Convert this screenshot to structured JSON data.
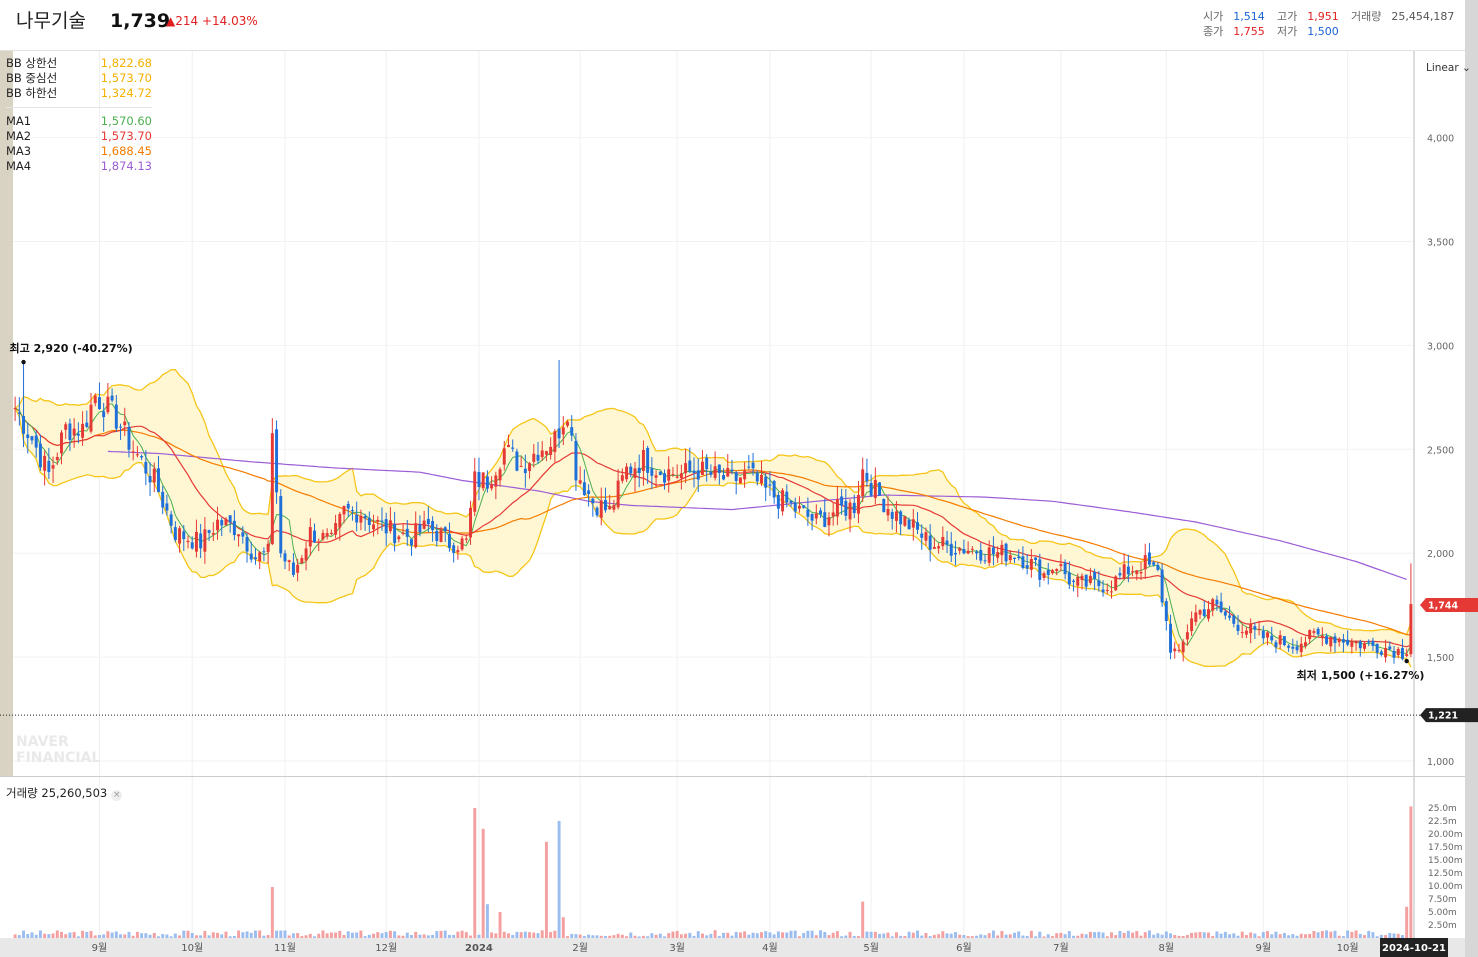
{
  "header": {
    "stock_name": "나무기술",
    "price": "1,739",
    "change": "▲214",
    "change_pct": "+14.03%",
    "open_label": "시가",
    "open": "1,514",
    "high_label": "고가",
    "high": "1,951",
    "volume_label": "거래량",
    "volume": "25,454,187",
    "close_label": "종가",
    "close": "1,755",
    "low_label": "저가",
    "low": "1,500"
  },
  "legend": {
    "bb": [
      {
        "label": "BB 상한선",
        "value": "1,822.68",
        "color": "#f5b100"
      },
      {
        "label": "BB 중심선",
        "value": "1,573.70",
        "color": "#f5b100"
      },
      {
        "label": "BB 하한선",
        "value": "1,324.72",
        "color": "#f5b100"
      }
    ],
    "ma": [
      {
        "label": "MA1",
        "value": "1,570.60",
        "color": "#4caf50"
      },
      {
        "label": "MA2",
        "value": "1,573.70",
        "color": "#e53935"
      },
      {
        "label": "MA3",
        "value": "1,688.45",
        "color": "#f57c00"
      },
      {
        "label": "MA4",
        "value": "1,874.13",
        "color": "#9c5dd6"
      }
    ]
  },
  "scale_mode": "Linear",
  "volume_label": "거래량 25,260,503",
  "watermark": "NAVER FINANCIAL",
  "chart_data": {
    "type": "candlestick",
    "y_ticks": [
      1000,
      1500,
      2000,
      2500,
      3000,
      3500,
      4000
    ],
    "y_tick_labels": [
      "1,000",
      "1,500",
      "2,000",
      "2,500",
      "3,000",
      "3,500",
      "4,000"
    ],
    "ylim": [
      900,
      4300
    ],
    "x_ticks": [
      {
        "i": 20,
        "label": "9월"
      },
      {
        "i": 42,
        "label": "10월"
      },
      {
        "i": 64,
        "label": "11월"
      },
      {
        "i": 88,
        "label": "12월"
      },
      {
        "i": 110,
        "label": "2024"
      },
      {
        "i": 134,
        "label": "2월"
      },
      {
        "i": 157,
        "label": "3월"
      },
      {
        "i": 179,
        "label": "4월"
      },
      {
        "i": 203,
        "label": "5월"
      },
      {
        "i": 225,
        "label": "6월"
      },
      {
        "i": 248,
        "label": "7월"
      },
      {
        "i": 273,
        "label": "8월"
      },
      {
        "i": 296,
        "label": "9월"
      },
      {
        "i": 316,
        "label": "10월"
      }
    ],
    "date_label": "2024-10-21",
    "price_tag": "1,744",
    "dotted_line_tag": "1,221",
    "dotted_line_value": 1221,
    "max_annotation": {
      "text": "최고 2,920 (-40.27%)",
      "i": 2,
      "value": 2920
    },
    "min_annotation": {
      "text": "최저 1,500 (+16.27%)",
      "i": 330,
      "value": 1500
    },
    "volume_ticks": [
      "2.50m",
      "5.00m",
      "7.50m",
      "10.00m",
      "12.50m",
      "15.00m",
      "17.50m",
      "20.00m",
      "22.5m",
      "25.0m"
    ],
    "volume_max": 25.0,
    "colors": {
      "up": "#e53935",
      "down": "#1e6fd9",
      "bb_fill": "#fff7d4",
      "bb_line": "#f5c518",
      "ma1": "#4caf50",
      "ma2": "#e53935",
      "ma3": "#f57c00",
      "ma4": "#9c5dd6"
    },
    "close_anchors": [
      [
        0,
        2700
      ],
      [
        4,
        2550
      ],
      [
        8,
        2380
      ],
      [
        12,
        2600
      ],
      [
        16,
        2600
      ],
      [
        19,
        2760
      ],
      [
        24,
        2650
      ],
      [
        28,
        2500
      ],
      [
        33,
        2350
      ],
      [
        38,
        2100
      ],
      [
        44,
        2050
      ],
      [
        48,
        2150
      ],
      [
        53,
        2120
      ],
      [
        57,
        1980
      ],
      [
        60,
        2000
      ],
      [
        61,
        2600
      ],
      [
        63,
        2000
      ],
      [
        66,
        1900
      ],
      [
        70,
        2100
      ],
      [
        75,
        2050
      ],
      [
        78,
        2200
      ],
      [
        82,
        2200
      ],
      [
        85,
        2150
      ],
      [
        90,
        2100
      ],
      [
        94,
        2080
      ],
      [
        98,
        2130
      ],
      [
        103,
        2050
      ],
      [
        107,
        2050
      ],
      [
        109,
        2350
      ],
      [
        112,
        2350
      ],
      [
        116,
        2500
      ],
      [
        120,
        2420
      ],
      [
        124,
        2500
      ],
      [
        128,
        2550
      ],
      [
        131,
        2700
      ],
      [
        133,
        2400
      ],
      [
        137,
        2250
      ],
      [
        141,
        2200
      ],
      [
        145,
        2400
      ],
      [
        149,
        2450
      ],
      [
        153,
        2400
      ],
      [
        158,
        2380
      ],
      [
        162,
        2400
      ],
      [
        166,
        2370
      ],
      [
        170,
        2350
      ],
      [
        174,
        2380
      ],
      [
        178,
        2300
      ],
      [
        182,
        2250
      ],
      [
        186,
        2200
      ],
      [
        190,
        2150
      ],
      [
        194,
        2200
      ],
      [
        199,
        2230
      ],
      [
        201,
        2400
      ],
      [
        204,
        2300
      ],
      [
        208,
        2200
      ],
      [
        213,
        2120
      ],
      [
        217,
        2050
      ],
      [
        222,
        2030
      ],
      [
        227,
        2020
      ],
      [
        232,
        2000
      ],
      [
        237,
        2000
      ],
      [
        241,
        1950
      ],
      [
        244,
        1900
      ],
      [
        247,
        1950
      ],
      [
        251,
        1850
      ],
      [
        256,
        1850
      ],
      [
        260,
        1850
      ],
      [
        264,
        1920
      ],
      [
        268,
        1950
      ],
      [
        271,
        1900
      ],
      [
        274,
        1550
      ],
      [
        276,
        1500
      ],
      [
        279,
        1700
      ],
      [
        284,
        1750
      ],
      [
        288,
        1680
      ],
      [
        291,
        1650
      ],
      [
        295,
        1600
      ],
      [
        299,
        1580
      ],
      [
        303,
        1560
      ],
      [
        308,
        1600
      ],
      [
        312,
        1600
      ],
      [
        316,
        1580
      ],
      [
        320,
        1560
      ],
      [
        324,
        1550
      ],
      [
        328,
        1530
      ],
      [
        330,
        1514
      ],
      [
        331,
        1755
      ]
    ],
    "ma4_anchors": [
      [
        22,
        2490
      ],
      [
        34,
        2480
      ],
      [
        56,
        2440
      ],
      [
        76,
        2410
      ],
      [
        96,
        2390
      ],
      [
        106,
        2350
      ],
      [
        124,
        2300
      ],
      [
        136,
        2250
      ],
      [
        146,
        2230
      ],
      [
        170,
        2210
      ],
      [
        190,
        2250
      ],
      [
        206,
        2280
      ],
      [
        230,
        2270
      ],
      [
        246,
        2250
      ],
      [
        264,
        2200
      ],
      [
        280,
        2150
      ],
      [
        300,
        2060
      ],
      [
        318,
        1960
      ],
      [
        330,
        1874
      ]
    ],
    "volume_spikes": [
      {
        "i": 61,
        "v": 9.8
      },
      {
        "i": 109,
        "v": 25.0
      },
      {
        "i": 111,
        "v": 21.0
      },
      {
        "i": 112,
        "v": 6.5
      },
      {
        "i": 115,
        "v": 5.0
      },
      {
        "i": 126,
        "v": 18.5
      },
      {
        "i": 129,
        "v": 22.5
      },
      {
        "i": 130,
        "v": 4.0
      },
      {
        "i": 201,
        "v": 7.0
      },
      {
        "i": 330,
        "v": 6.0
      },
      {
        "i": 331,
        "v": 25.3
      }
    ]
  }
}
